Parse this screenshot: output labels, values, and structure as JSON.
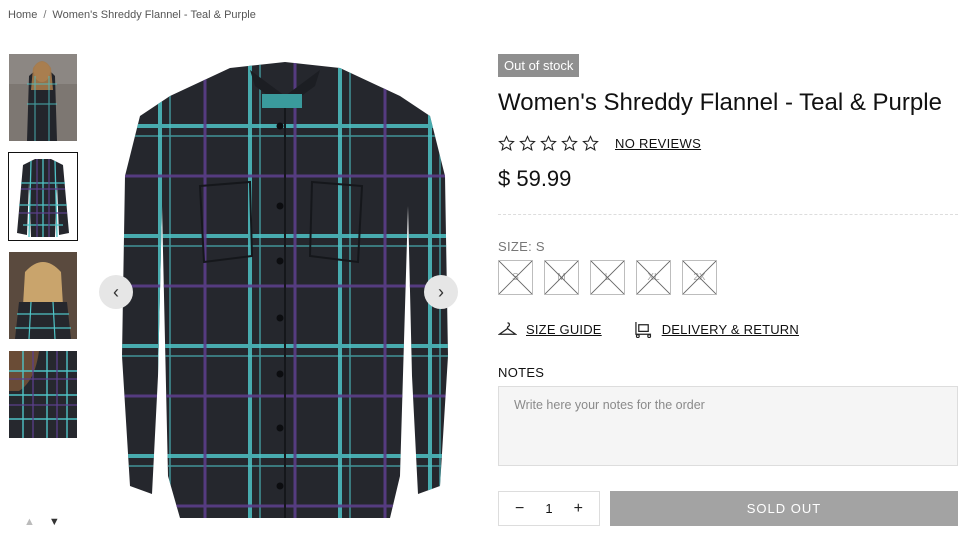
{
  "breadcrumb": {
    "home": "Home",
    "separator": "/",
    "current": "Women's Shreddy Flannel - Teal & Purple"
  },
  "thumbnails": [
    {
      "name": "thumb-model-front"
    },
    {
      "name": "thumb-product-flat"
    },
    {
      "name": "thumb-model-back"
    },
    {
      "name": "thumb-detail"
    }
  ],
  "gallery": {
    "prev_icon": "chevron-left-icon",
    "next_icon": "chevron-right-icon"
  },
  "product": {
    "badge": "Out of stock",
    "title": "Women's Shreddy Flannel - Teal & Purple",
    "rating_stars": 0,
    "reviews_label": "NO REVIEWS",
    "price": "$ 59.99",
    "size_label": "SIZE: S",
    "sizes": [
      "S",
      "M",
      "L",
      "XL",
      "2X"
    ],
    "size_guide_label": "SIZE GUIDE",
    "delivery_label": "DELIVERY & RETURN",
    "notes_label": "NOTES",
    "notes_placeholder": "Write here your notes for the order",
    "quantity": "1",
    "minus": "−",
    "plus": "+",
    "sold_out_label": "SOLD OUT"
  },
  "colors": {
    "badge_bg": "#8f8f8f",
    "sold_out_bg": "#a3a3a3",
    "plaid_teal": "#4fc3c6",
    "plaid_purple": "#5b3f8a",
    "shirt_base": "#25272d"
  }
}
